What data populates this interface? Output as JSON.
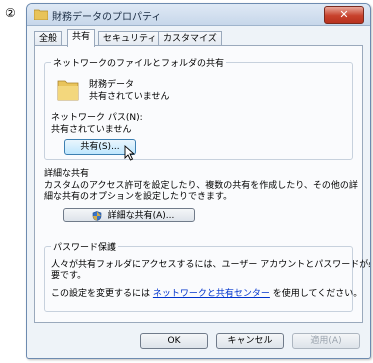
{
  "step_marker": "②",
  "window": {
    "title": "財務データのプロパティ",
    "close_symbol": "✕"
  },
  "tabs": [
    {
      "label": "全般"
    },
    {
      "label": "共有",
      "active": true
    },
    {
      "label": "セキュリティ"
    },
    {
      "label": "カスタマイズ"
    }
  ],
  "network_share": {
    "legend": "ネットワークのファイルとフォルダの共有",
    "folder_name": "財務データ",
    "folder_status": "共有されていません",
    "path_label": "ネットワーク パス(N):",
    "path_value": "共有されていません",
    "share_button": "共有(S)..."
  },
  "advanced_share": {
    "legend": "詳細な共有",
    "description_line1": "カスタムのアクセス許可を設定したり、複数の共有を作成したり、その他の詳",
    "description_line2": "細な共有のオプションを設定したりできます。",
    "button": "詳細な共有(A)..."
  },
  "password": {
    "legend": "パスワード保護",
    "line1": "人々が共有フォルダにアクセスするには、ユーザー アカウントとパスワードが必",
    "line2": "要です。",
    "change_prefix": "この設定を変更するには",
    "link": "ネットワークと共有センター",
    "change_suffix": "を使用してください。"
  },
  "footer": {
    "ok": "OK",
    "cancel": "キャンセル",
    "apply": "適用(A)"
  },
  "colors": {
    "accent": "#3c7fb1",
    "link": "#0033cc",
    "close": "#c7412c"
  }
}
